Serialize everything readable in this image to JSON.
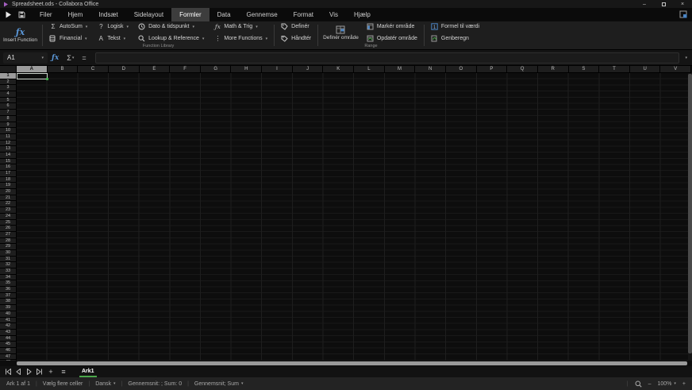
{
  "window": {
    "title": "Spreadsheet.ods - Collabora Office"
  },
  "menu": {
    "items": [
      "Filer",
      "Hjem",
      "Indsæt",
      "Sidelayout",
      "Formler",
      "Data",
      "Gennemse",
      "Format",
      "Vis",
      "Hjælp"
    ],
    "active": "Formler"
  },
  "ribbon": {
    "insert_function": {
      "label": "Insert Function"
    },
    "function_library": {
      "label": "Function Library",
      "buttons": [
        {
          "label": "AutoSum"
        },
        {
          "label": "Financial"
        },
        {
          "label": "Logisk"
        },
        {
          "label": "Tekst"
        },
        {
          "label": "Dato & tidspunkt"
        },
        {
          "label": "Lookup & Reference"
        },
        {
          "label": "Math & Trig"
        },
        {
          "label": "More Functions"
        }
      ]
    },
    "names": {
      "define": "Definér",
      "manage": "Håndtér"
    },
    "range": {
      "label": "Range",
      "define_range": "Definér område",
      "select_range": "Markér område",
      "update_range": "Opdatér område"
    },
    "calc": {
      "formula_to_value": "Formel til værdi",
      "recalculate": "Genberegn"
    }
  },
  "formula_bar": {
    "cell_reference": "A1",
    "formula_value": ""
  },
  "grid": {
    "columns": [
      "A",
      "B",
      "C",
      "D",
      "E",
      "F",
      "G",
      "H",
      "I",
      "J",
      "K",
      "L",
      "M",
      "N",
      "O",
      "P",
      "Q",
      "R",
      "S",
      "T",
      "U",
      "V"
    ],
    "row_count": 48,
    "selected_cell": "A1",
    "selected_column": "A",
    "selected_row": 1
  },
  "sheet_bar": {
    "tabs": [
      {
        "label": "Ark1",
        "active": true
      }
    ]
  },
  "status_bar": {
    "sheet_info": "Ark 1 af 1",
    "selection_mode": "Vælg flere celler",
    "language": "Dansk",
    "stats": "Gennemsnit: ; Sum: 0",
    "stats_selector": "Gennemsnit; Sum",
    "zoom_level": "100%"
  },
  "icons": {
    "sigma": "Σ",
    "question": "?",
    "letter_a": "A",
    "vertical_ellipsis": "⋮",
    "fx": "ƒx",
    "equals": "=",
    "caret": "▾",
    "hamburger": "≡",
    "plus": "+",
    "minus": "–",
    "times": "×"
  },
  "colors": {
    "accent_green": "#3fae4a",
    "accent_blue": "#5a96d6",
    "selection_border": "#cdd5cd"
  }
}
